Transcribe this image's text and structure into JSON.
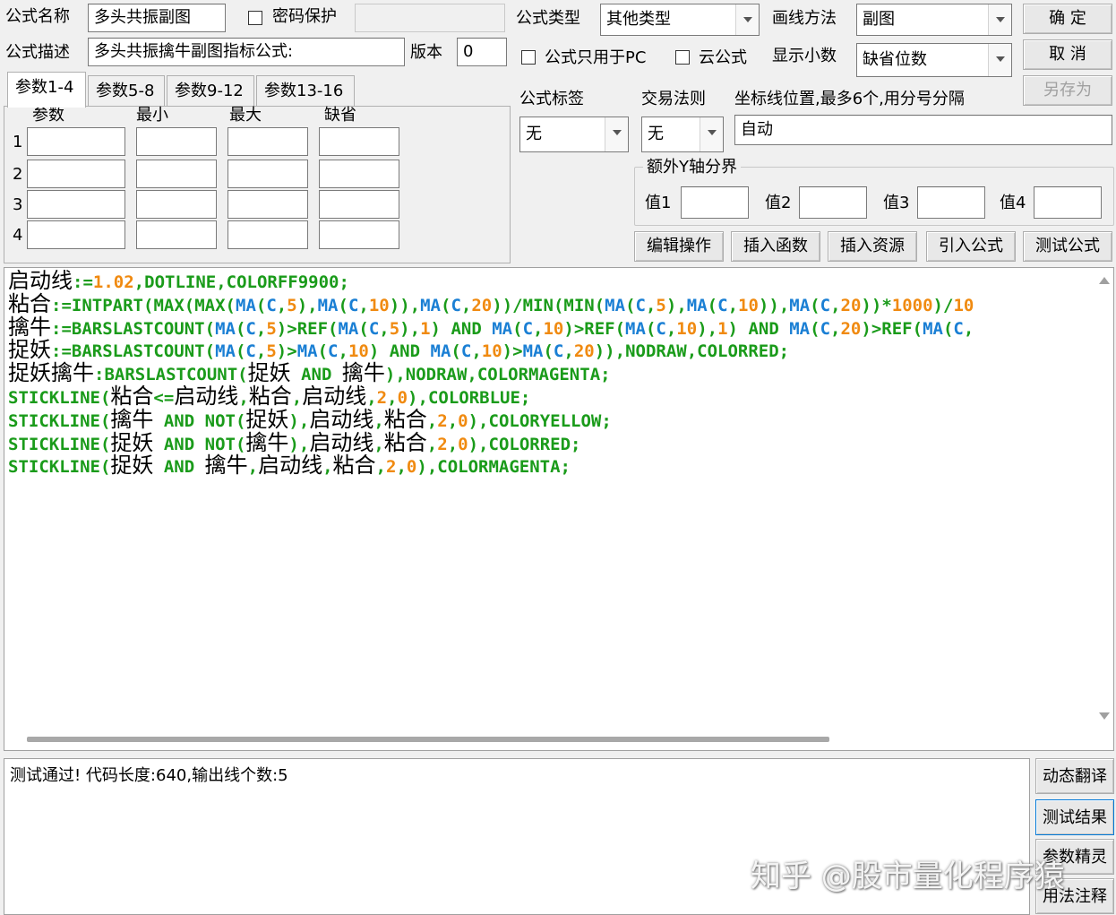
{
  "form": {
    "name_label": "公式名称",
    "name_value": "多头共振副图",
    "password_label": "密码保护",
    "desc_label": "公式描述",
    "desc_value": "多头共振擒牛副图指标公式:",
    "version_label": "版本",
    "version_value": "0",
    "type_label": "公式类型",
    "type_value": "其他类型",
    "draw_label": "画线方法",
    "draw_value": "副图",
    "pc_only_label": "公式只用于PC",
    "cloud_label": "云公式",
    "decimals_label": "显示小数",
    "decimals_value": "缺省位数",
    "tag_label": "公式标签",
    "tag_value": "无",
    "trade_label": "交易法则",
    "trade_value": "无",
    "axis_label": "坐标线位置,最多6个,用分号分隔",
    "axis_value": "自动",
    "extra_y_label": "额外Y轴分界",
    "val1_label": "值1",
    "val2_label": "值2",
    "val3_label": "值3",
    "val4_label": "值4"
  },
  "buttons": {
    "ok": "确 定",
    "cancel": "取 消",
    "save_as": "另存为",
    "edit_ops": "编辑操作",
    "insert_func": "插入函数",
    "insert_res": "插入资源",
    "import_formula": "引入公式",
    "test_formula": "测试公式"
  },
  "param_tabs": [
    "参数1-4",
    "参数5-8",
    "参数9-12",
    "参数13-16"
  ],
  "param_headers": [
    "参数",
    "最小",
    "最大",
    "缺省"
  ],
  "param_rows": [
    "1",
    "2",
    "3",
    "4"
  ],
  "code_lines": [
    "启动线:=1.02,DOTLINE,COLORFF9900;",
    "粘合:=INTPART(MAX(MAX(MA(C,5),MA(C,10)),MA(C,20))/MIN(MIN(MA(C,5),MA(C,10)),MA(C,20))*1000)/10",
    "擒牛:=BARSLASTCOUNT(MA(C,5)>REF(MA(C,5),1) AND MA(C,10)>REF(MA(C,10),1) AND MA(C,20)>REF(MA(C,",
    "捉妖:=BARSLASTCOUNT(MA(C,5)>MA(C,10) AND MA(C,10)>MA(C,20)),NODRAW,COLORRED;",
    "捉妖擒牛:BARSLASTCOUNT(捉妖 AND 擒牛),NODRAW,COLORMAGENTA;",
    "STICKLINE(粘合<=启动线,粘合,启动线,2,0),COLORBLUE;",
    "STICKLINE(擒牛 AND NOT(捉妖),启动线,粘合,2,0),COLORYELLOW;",
    "STICKLINE(捉妖 AND NOT(擒牛),启动线,粘合,2,0),COLORRED;",
    "STICKLINE(捉妖 AND 擒牛,启动线,粘合,2,0),COLORMAGENTA;"
  ],
  "output_text": "测试通过! 代码长度:640,输出线个数:5",
  "side_buttons": [
    "动态翻译",
    "测试结果",
    "参数精灵",
    "用法注释"
  ],
  "watermark": "知乎 @股市量化程序猿",
  "colors": {
    "keyword": "#1a9b1a",
    "function": "#1a7fd4",
    "number": "#f08a10",
    "text": "#000000"
  }
}
